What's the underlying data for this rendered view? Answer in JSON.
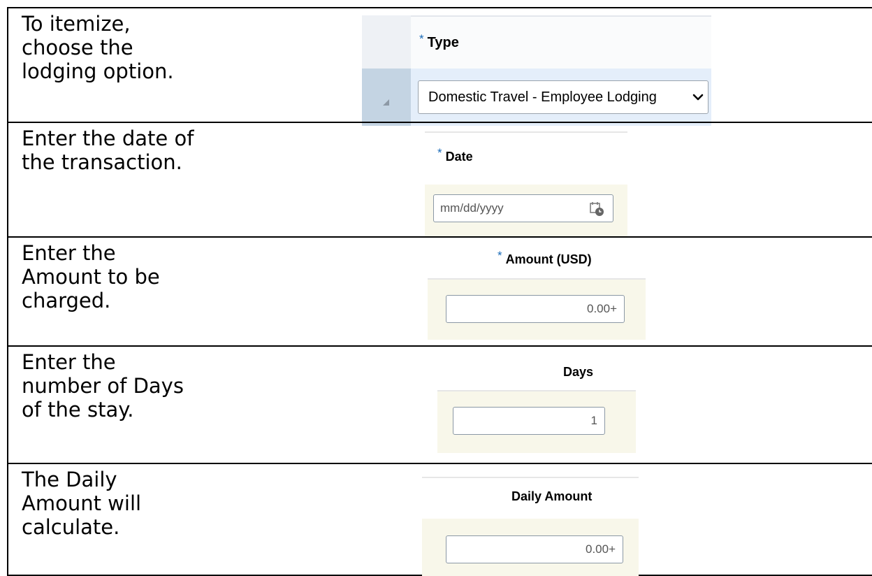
{
  "rows": [
    {
      "instruction": "To itemize, choose the lodging option.",
      "field": {
        "label": "Type",
        "required": "*",
        "value": "Domestic Travel - Employee Lodging",
        "control": "select",
        "icon": "chevron-down-icon"
      }
    },
    {
      "instruction": "Enter the date of the transaction.",
      "field": {
        "label": "Date",
        "required": "*",
        "placeholder": "mm/dd/yyyy",
        "control": "date",
        "icon": "calendar-icon"
      }
    },
    {
      "instruction": "Enter the Amount to be charged.",
      "field": {
        "label": "Amount (USD)",
        "required": "*",
        "value": "0.00+",
        "control": "number"
      }
    },
    {
      "instruction": "Enter the number of Days of the stay.",
      "field": {
        "label": "Days",
        "value": "1",
        "control": "number"
      }
    },
    {
      "instruction": "The Daily Amount will calculate.",
      "field": {
        "label": "Daily Amount",
        "value": "0.00+",
        "control": "number"
      }
    }
  ],
  "colors": {
    "required_asterisk": "#1a6bb8",
    "field_background": "#f8f7ea",
    "selected_row": "#e4eefa"
  }
}
